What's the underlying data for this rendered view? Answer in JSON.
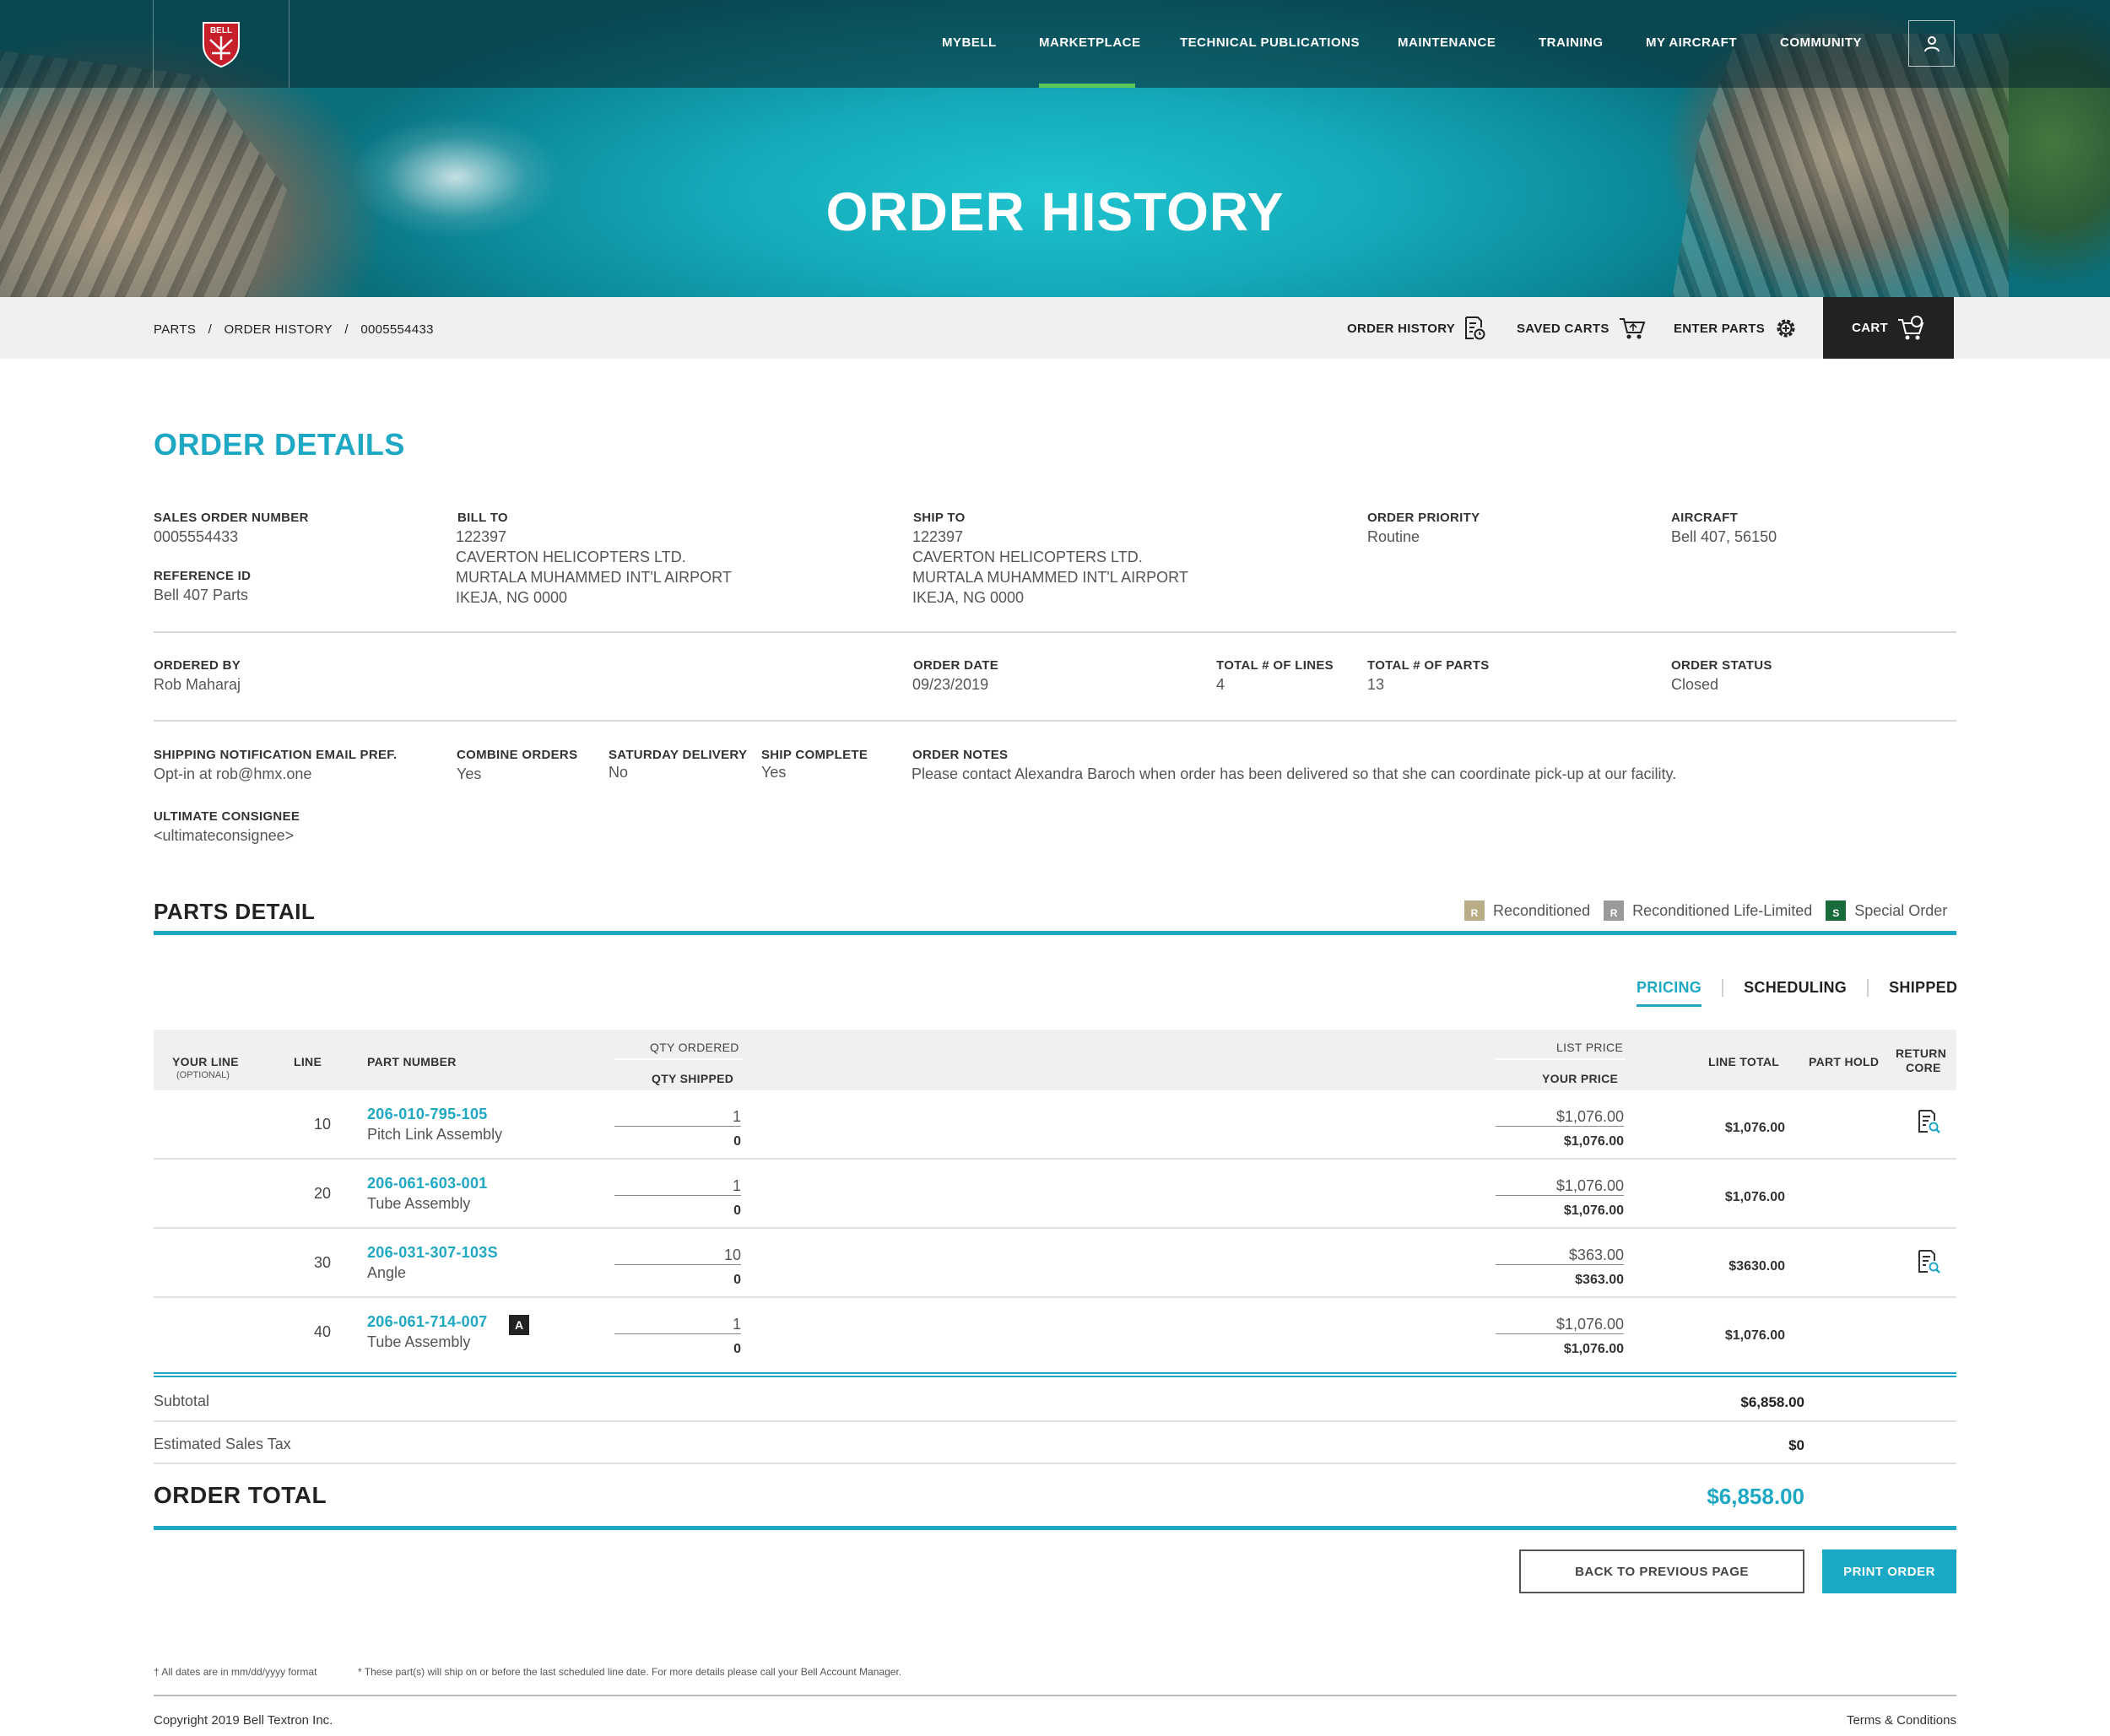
{
  "brand": {
    "logo_text": "BELL"
  },
  "nav": {
    "items": [
      "MYBELL",
      "MARKETPLACE",
      "TECHNICAL PUBLICATIONS",
      "MAINTENANCE",
      "TRAINING",
      "MY AIRCRAFT",
      "COMMUNITY"
    ],
    "active": "MARKETPLACE",
    "user_icon": "user-icon"
  },
  "hero": {
    "title": "ORDER HISTORY"
  },
  "breadcrumb": [
    "PARTS",
    "/",
    "ORDER HISTORY",
    "/",
    "0005554433"
  ],
  "subnav": {
    "order_history": "ORDER HISTORY",
    "saved_carts": "SAVED CARTS",
    "enter_parts": "ENTER PARTS",
    "cart": "CART"
  },
  "order_details": {
    "heading": "ORDER DETAILS",
    "sales_order_number": {
      "label": "SALES ORDER NUMBER",
      "value": "0005554433"
    },
    "reference_id": {
      "label": "REFERENCE ID",
      "value": "Bell 407 Parts"
    },
    "bill_to": {
      "label": "BILL TO",
      "lines": [
        "122397",
        "CAVERTON HELICOPTERS LTD.",
        "MURTALA MUHAMMED INT'L AIRPORT",
        "IKEJA, NG 0000"
      ]
    },
    "ship_to": {
      "label": "SHIP TO",
      "lines": [
        "122397",
        "CAVERTON HELICOPTERS LTD.",
        "MURTALA MUHAMMED INT'L AIRPORT",
        "IKEJA, NG 0000"
      ]
    },
    "order_priority": {
      "label": "ORDER PRIORITY",
      "value": "Routine"
    },
    "aircraft": {
      "label": "AIRCRAFT",
      "value": "Bell 407, 56150"
    },
    "ordered_by": {
      "label": "ORDERED BY",
      "value": "Rob Maharaj"
    },
    "order_date": {
      "label": "ORDER DATE",
      "value": "09/23/2019"
    },
    "total_lines": {
      "label": "TOTAL # OF LINES",
      "value": "4"
    },
    "total_parts": {
      "label": "TOTAL # OF PARTS",
      "value": "13"
    },
    "order_status": {
      "label": "ORDER STATUS",
      "value": "Closed"
    },
    "shipping_email": {
      "label": "SHIPPING NOTIFICATION EMAIL PREF.",
      "value": "Opt-in at rob@hmx.one"
    },
    "combine_orders": {
      "label": "COMBINE ORDERS",
      "value": "Yes"
    },
    "saturday_delivery": {
      "label": "SATURDAY DELIVERY",
      "value": "No"
    },
    "ship_complete": {
      "label": "SHIP COMPLETE",
      "value": "Yes"
    },
    "order_notes": {
      "label": "ORDER NOTES",
      "value": "Please contact Alexandra Baroch when order has been delivered so that she can coordinate pick-up at our facility."
    },
    "ultimate_consignee": {
      "label": "ULTIMATE CONSIGNEE",
      "value": "<ultimateconsignee>"
    }
  },
  "parts_detail": {
    "heading": "PARTS DETAIL",
    "legend": [
      {
        "code": "R",
        "label": "Reconditioned",
        "color": "#b8ad86"
      },
      {
        "code": "R",
        "label": "Reconditioned Life-Limited",
        "color": "#9a9a9a"
      },
      {
        "code": "S",
        "label": "Special Order",
        "color": "#1a6b3c"
      }
    ],
    "tabs": [
      "PRICING",
      "SCHEDULING",
      "SHIPPED"
    ],
    "active_tab": "PRICING",
    "columns": {
      "your_line": "YOUR LINE",
      "your_line_sub": "(OPTIONAL)",
      "line": "LINE",
      "part_number": "PART NUMBER",
      "qty_ordered": "QTY ORDERED",
      "qty_shipped": "QTY SHIPPED",
      "list_price": "LIST PRICE",
      "your_price": "YOUR PRICE",
      "line_total": "LINE TOTAL",
      "part_hold": "PART HOLD",
      "return_core_1": "RETURN",
      "return_core_2": "CORE"
    },
    "rows": [
      {
        "line": "10",
        "part_number": "206-010-795-105",
        "description": "Pitch Link Assembly",
        "qty_ordered": "1",
        "qty_shipped": "0",
        "list_price": "$1,076.00",
        "your_price": "$1,076.00",
        "line_total": "$1,076.00",
        "return_core_icon": true,
        "badge": ""
      },
      {
        "line": "20",
        "part_number": "206-061-603-001",
        "description": "Tube Assembly",
        "qty_ordered": "1",
        "qty_shipped": "0",
        "list_price": "$1,076.00",
        "your_price": "$1,076.00",
        "line_total": "$1,076.00",
        "return_core_icon": false,
        "badge": ""
      },
      {
        "line": "30",
        "part_number": "206-031-307-103S",
        "description": "Angle",
        "qty_ordered": "10",
        "qty_shipped": "0",
        "list_price": "$363.00",
        "your_price": "$363.00",
        "line_total": "$3630.00",
        "return_core_icon": true,
        "badge": ""
      },
      {
        "line": "40",
        "part_number": "206-061-714-007",
        "description": "Tube Assembly",
        "qty_ordered": "1",
        "qty_shipped": "0",
        "list_price": "$1,076.00",
        "your_price": "$1,076.00",
        "line_total": "$1,076.00",
        "return_core_icon": false,
        "badge": "A"
      }
    ],
    "subtotal": {
      "label": "Subtotal",
      "value": "$6,858.00"
    },
    "sales_tax": {
      "label": "Estimated Sales Tax",
      "value": "$0"
    },
    "order_total": {
      "label": "ORDER TOTAL",
      "value": "$6,858.00"
    }
  },
  "buttons": {
    "back": "BACK TO PREVIOUS PAGE",
    "print": "PRINT ORDER"
  },
  "footer": {
    "note_dates": "† All dates are in mm/dd/yyyy format",
    "note_ship": "* These part(s) will ship on or before the last scheduled line date. For more details please call your Bell Account Manager.",
    "copyright": "Copyright 2019 Bell Textron Inc.",
    "terms": "Terms & Conditions"
  },
  "colors": {
    "accent": "#1ea8c3",
    "nav_active": "#5cc85a",
    "dark": "#222222"
  }
}
